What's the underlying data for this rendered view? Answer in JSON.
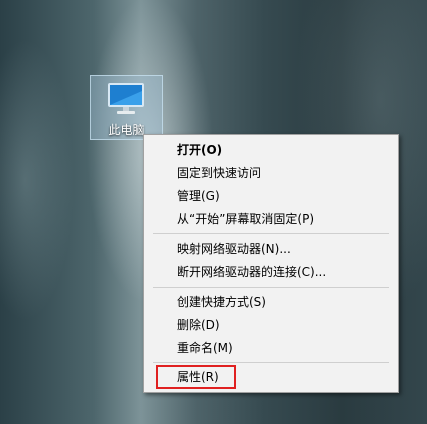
{
  "desktop": {
    "icon": {
      "label": "此电脑",
      "icon_name": "computer-monitor-icon"
    }
  },
  "context_menu": {
    "items": [
      {
        "label": "打开(O)",
        "bold": true
      },
      {
        "label": "固定到快速访问"
      },
      {
        "label": "管理(G)"
      },
      {
        "label": "从“开始”屏幕取消固定(P)"
      },
      {
        "label": "映射网络驱动器(N)..."
      },
      {
        "label": "断开网络驱动器的连接(C)..."
      },
      {
        "label": "创建快捷方式(S)"
      },
      {
        "label": "删除(D)"
      },
      {
        "label": "重命名(M)"
      },
      {
        "label": "属性(R)"
      }
    ],
    "highlighted_item": "属性(R)",
    "highlight_color": "#e02020"
  }
}
